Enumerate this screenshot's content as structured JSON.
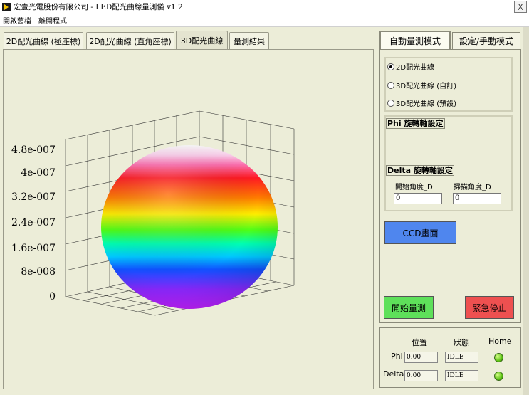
{
  "window": {
    "title": "宏壹光電股份有限公司 - LED配光曲線量測儀 v1.2",
    "close_glyph": "X"
  },
  "menu": [
    "開啟舊檔",
    "離開程式"
  ],
  "left_tabs": [
    {
      "label": "2D配光曲線 (極座標)",
      "active": false
    },
    {
      "label": "2D配光曲線 (直角座標)",
      "active": false
    },
    {
      "label": "3D配光曲線",
      "active": true
    },
    {
      "label": "量測結果",
      "active": false
    }
  ],
  "plot": {
    "z_ticks": [
      "4.8e-007",
      "4e-007",
      "3.2e-007",
      "2.4e-007",
      "1.6e-007",
      "8e-008",
      "0"
    ],
    "z_values": [
      4.8e-07,
      4e-07,
      3.2e-07,
      2.4e-07,
      1.6e-07,
      8e-08,
      0
    ]
  },
  "right_tabs": [
    {
      "label": "自動量測模式",
      "active": true
    },
    {
      "label": "設定/手動模式",
      "active": false
    }
  ],
  "modes": [
    {
      "label": "2D配光曲線",
      "selected": true
    },
    {
      "label": "3D配光曲線 (自訂)",
      "selected": false
    },
    {
      "label": "3D配光曲線 (預設)",
      "selected": false
    }
  ],
  "phi_settings": {
    "label": "Phi 旋轉軸設定"
  },
  "delta_settings": {
    "label": "Delta 旋轉軸設定",
    "start_caption": "開始角度_D",
    "scan_caption": "掃描角度_D",
    "start_value": "0",
    "scan_value": "0"
  },
  "buttons": {
    "ccd": "CCD畫面",
    "start": "開始量測",
    "stop": "緊急停止"
  },
  "status": {
    "col_position": "位置",
    "col_state": "狀態",
    "col_home": "Home",
    "rows": [
      {
        "axis": "Phi",
        "position": "0.00",
        "state": "IDLE"
      },
      {
        "axis": "Delta",
        "position": "0.00",
        "state": "IDLE"
      }
    ]
  },
  "colors": {
    "ccd_button": "#4f86ee",
    "start_button": "#5ee05a",
    "stop_button": "#ee5050",
    "led_home": "#5fc416"
  }
}
